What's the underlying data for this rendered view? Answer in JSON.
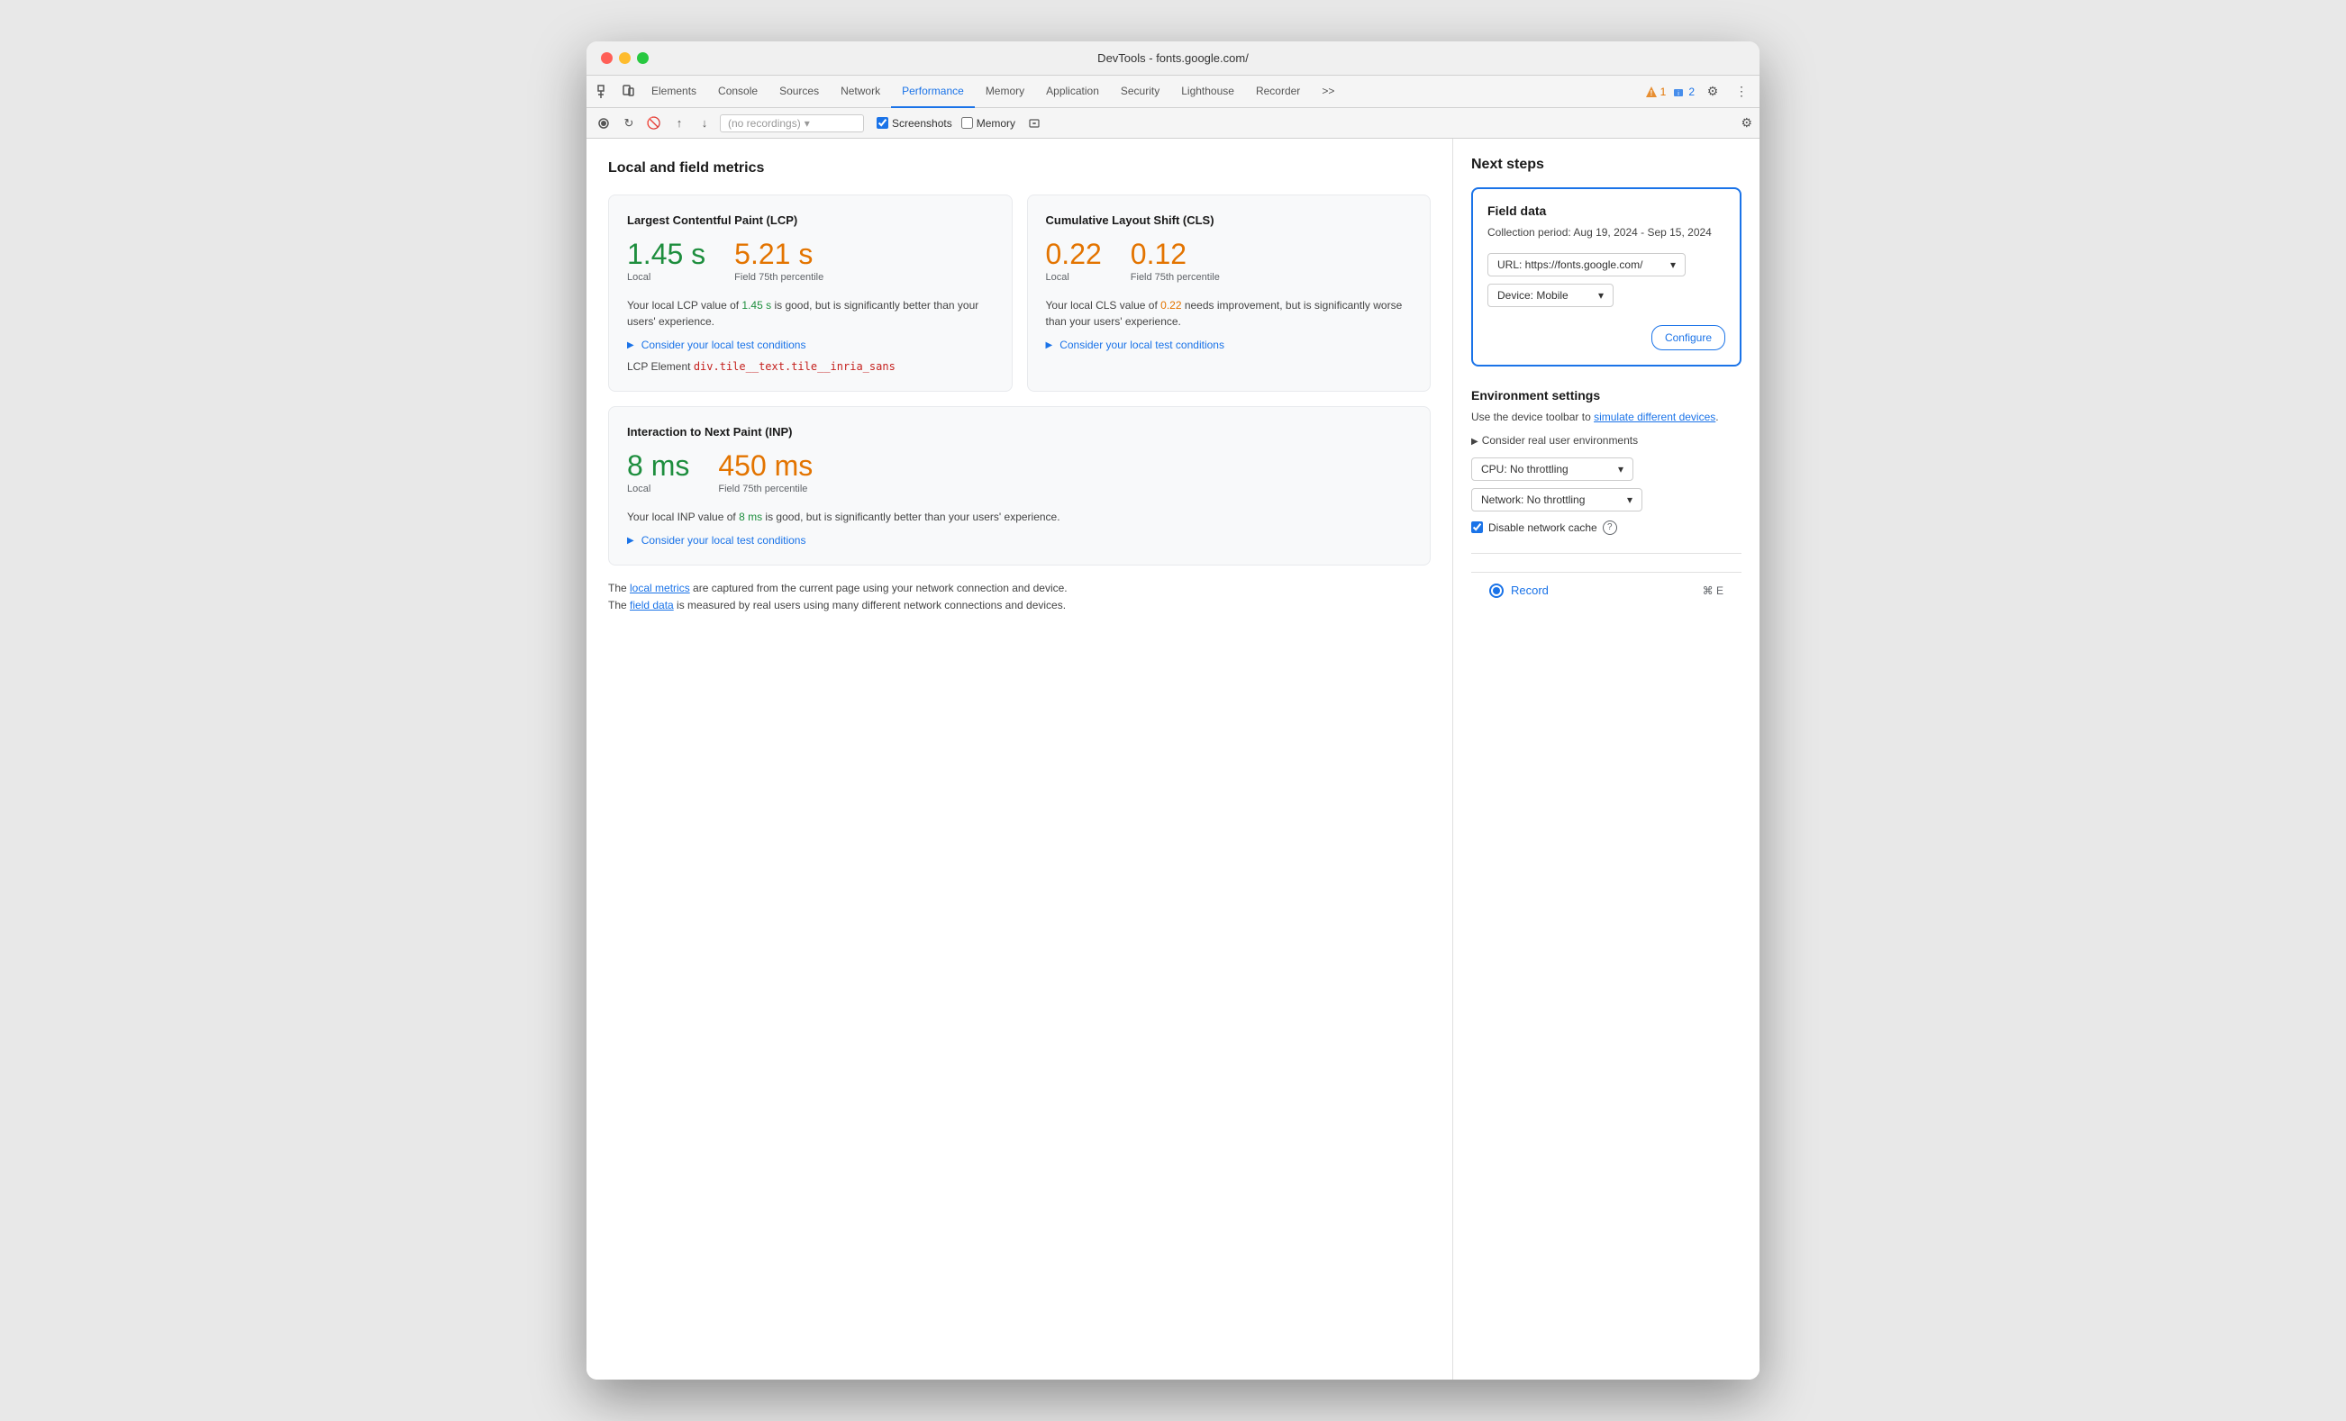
{
  "window": {
    "title": "DevTools - fonts.google.com/"
  },
  "nav": {
    "tabs": [
      {
        "id": "elements",
        "label": "Elements",
        "active": false
      },
      {
        "id": "console",
        "label": "Console",
        "active": false
      },
      {
        "id": "sources",
        "label": "Sources",
        "active": false
      },
      {
        "id": "network",
        "label": "Network",
        "active": false
      },
      {
        "id": "performance",
        "label": "Performance",
        "active": true
      },
      {
        "id": "memory",
        "label": "Memory",
        "active": false
      },
      {
        "id": "application",
        "label": "Application",
        "active": false
      },
      {
        "id": "security",
        "label": "Security",
        "active": false
      },
      {
        "id": "lighthouse",
        "label": "Lighthouse",
        "active": false
      },
      {
        "id": "recorder",
        "label": "Recorder",
        "active": false
      }
    ],
    "overflow": ">>",
    "warning_count": "1",
    "info_count": "2"
  },
  "toolbar": {
    "recording_placeholder": "(no recordings)",
    "screenshots_label": "Screenshots",
    "memory_label": "Memory",
    "screenshots_checked": true,
    "memory_checked": false
  },
  "left_panel": {
    "title": "Local and field metrics",
    "lcp": {
      "title": "Largest Contentful Paint (LCP)",
      "local_value": "1.45 s",
      "field_value": "5.21 s",
      "local_label": "Local",
      "field_label": "Field 75th percentile",
      "description_before": "Your local LCP value of ",
      "highlight_local": "1.45 s",
      "description_middle": " is good, but is significantly better than your users' experience.",
      "consider_link": "Consider your local test conditions",
      "lcp_element_prefix": "LCP Element",
      "lcp_element_value": "div.tile__text.tile__inria_sans"
    },
    "cls": {
      "title": "Cumulative Layout Shift (CLS)",
      "local_value": "0.22",
      "field_value": "0.12",
      "local_label": "Local",
      "field_label": "Field 75th percentile",
      "description_before": "Your local CLS value of ",
      "highlight_local": "0.22",
      "description_middle": " needs improvement, but is significantly worse than your users' experience.",
      "consider_link": "Consider your local test conditions"
    },
    "inp": {
      "title": "Interaction to Next Paint (INP)",
      "local_value": "8 ms",
      "field_value": "450 ms",
      "local_label": "Local",
      "field_label": "Field 75th percentile",
      "description_before": "Your local INP value of ",
      "highlight_local": "8 ms",
      "description_middle": " is good, but is significantly better than your users' experience.",
      "consider_link": "Consider your local test conditions"
    },
    "footer_line1_before": "The ",
    "footer_link1": "local metrics",
    "footer_line1_after": " are captured from the current page using your network connection and device.",
    "footer_line2_before": "The ",
    "footer_link2": "field data",
    "footer_line2_after": " is measured by real users using many different network connections and devices."
  },
  "right_panel": {
    "title": "Next steps",
    "field_data": {
      "title": "Field data",
      "collection_period": "Collection period: Aug 19, 2024 - Sep 15, 2024",
      "url_label": "URL: https://fonts.google.com/",
      "device_label": "Device: Mobile",
      "configure_label": "Configure"
    },
    "env_settings": {
      "title": "Environment settings",
      "description_before": "Use the device toolbar to ",
      "description_link": "simulate different devices",
      "description_after": ".",
      "consider_label": "Consider real user environments",
      "cpu_label": "CPU: No throttling",
      "network_label": "Network: No throttling",
      "disable_cache_label": "Disable network cache"
    },
    "record": {
      "label": "Record",
      "shortcut": "⌘ E"
    }
  }
}
